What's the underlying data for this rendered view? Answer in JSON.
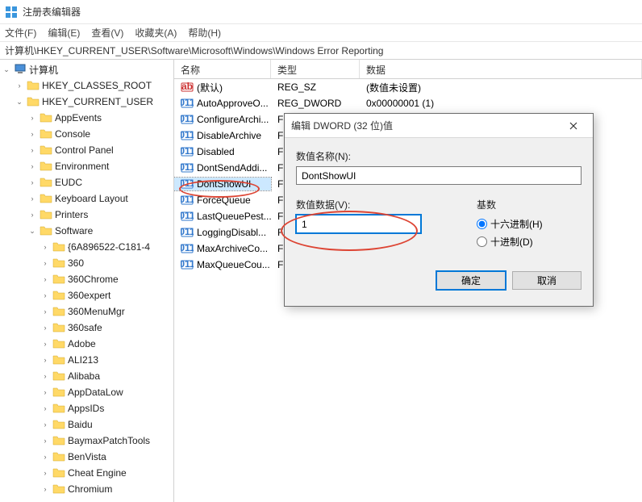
{
  "app": {
    "title": "注册表编辑器"
  },
  "menu": {
    "file": "文件(F)",
    "edit": "编辑(E)",
    "view": "查看(V)",
    "favorites": "收藏夹(A)",
    "help": "帮助(H)"
  },
  "address": "计算机\\HKEY_CURRENT_USER\\Software\\Microsoft\\Windows\\Windows Error Reporting",
  "tree": {
    "root": "计算机",
    "hkcr": "HKEY_CLASSES_ROOT",
    "hkcu": "HKEY_CURRENT_USER",
    "items": [
      "AppEvents",
      "Console",
      "Control Panel",
      "Environment",
      "EUDC",
      "Keyboard Layout",
      "Printers",
      "Software"
    ],
    "software_items": [
      "{6A896522-C181-4",
      "360",
      "360Chrome",
      "360expert",
      "360MenuMgr",
      "360safe",
      "Adobe",
      "ALI213",
      "Alibaba",
      "AppDataLow",
      "AppsIDs",
      "Baidu",
      "BaymaxPatchTools",
      "BenVista",
      "Cheat Engine",
      "Chromium"
    ]
  },
  "list": {
    "headers": {
      "name": "名称",
      "type": "类型",
      "data": "数据"
    },
    "rows": [
      {
        "name": "(默认)",
        "type": "REG_SZ",
        "data": "(数值未设置)",
        "icon": "str"
      },
      {
        "name": "AutoApproveO...",
        "type": "REG_DWORD",
        "data": "0x00000001 (1)",
        "icon": "bin"
      },
      {
        "name": "ConfigureArchi...",
        "type": "F",
        "data": "",
        "icon": "bin"
      },
      {
        "name": "DisableArchive",
        "type": "F",
        "data": "",
        "icon": "bin"
      },
      {
        "name": "Disabled",
        "type": "F",
        "data": "",
        "icon": "bin"
      },
      {
        "name": "DontSendAddi...",
        "type": "F",
        "data": "",
        "icon": "bin"
      },
      {
        "name": "DontShowUI",
        "type": "F",
        "data": "",
        "icon": "bin",
        "selected": true
      },
      {
        "name": "ForceQueue",
        "type": "F",
        "data": "",
        "icon": "bin"
      },
      {
        "name": "LastQueuePest...",
        "type": "F",
        "data": "",
        "icon": "bin"
      },
      {
        "name": "LoggingDisabl...",
        "type": "F",
        "data": "",
        "icon": "bin"
      },
      {
        "name": "MaxArchiveCo...",
        "type": "F",
        "data": "",
        "icon": "bin"
      },
      {
        "name": "MaxQueueCou...",
        "type": "F",
        "data": "",
        "icon": "bin"
      }
    ]
  },
  "dialog": {
    "title": "编辑 DWORD (32 位)值",
    "name_label": "数值名称(N):",
    "name_value": "DontShowUI",
    "data_label": "数值数据(V):",
    "data_value": "1",
    "base_label": "基数",
    "hex_label": "十六进制(H)",
    "dec_label": "十进制(D)",
    "ok": "确定",
    "cancel": "取消"
  }
}
